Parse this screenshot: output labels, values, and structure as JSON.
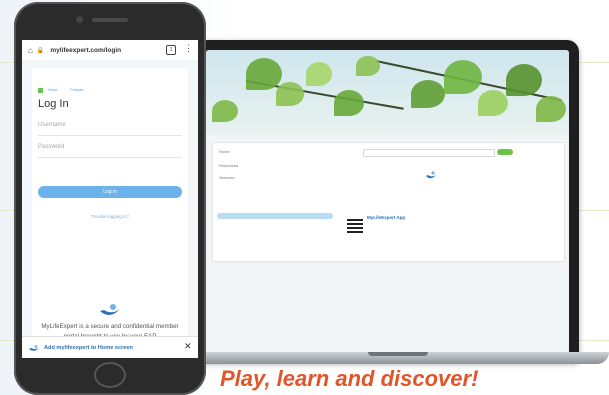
{
  "tagline": "Play, learn and discover!",
  "phone": {
    "url": "mylifeexpert.com/login",
    "tab_count": "1",
    "login": {
      "title": "Log In",
      "username_placeholder": "Username",
      "password_placeholder": "Password",
      "login_button": "Log in",
      "forgot_link": "Trouble logging in?",
      "top_links": [
        "Home",
        "Français"
      ]
    },
    "description": "MyLifeExpert is a secure and confidential member portal brought to you by your EAP",
    "add_to_home": "Add mylifeexpert to Home screen"
  },
  "laptop": {
    "sidebar_items": [
      "Home",
      "Resources",
      "Services"
    ],
    "app_promo_title": "MyLifeExpert App"
  },
  "colors": {
    "tagline": "#e2552b",
    "accent_blue": "#6cb3ea",
    "leaf_green": "#67a838",
    "add_to_home_text": "#2f6fb4"
  },
  "icons": [
    "lock-icon",
    "home-icon",
    "tabs-icon",
    "kebab-menu-icon",
    "close-icon",
    "app-logo-icon",
    "qr-code-icon"
  ]
}
